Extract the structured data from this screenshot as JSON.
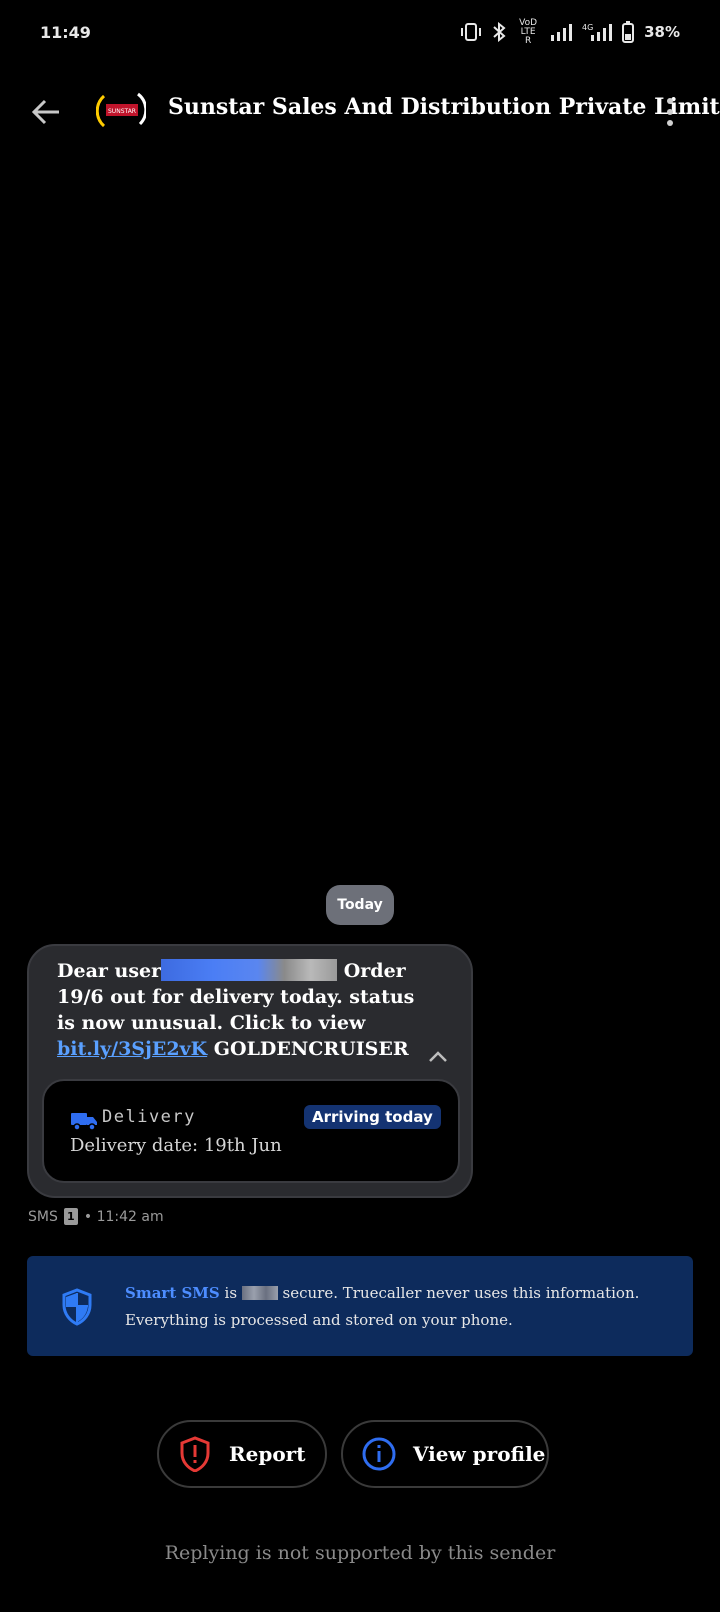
{
  "status_bar": {
    "time": "11:49",
    "network_volte": "VoD LTE R",
    "network_4g": "4G",
    "battery": "38%"
  },
  "header": {
    "sender_name": "Sunstar Sales And Distribution Private Limited",
    "avatar_text": "SUNSTAR"
  },
  "conversation": {
    "date_separator": "Today",
    "message": {
      "text_before_redaction": "Dear user",
      "text_after_redaction": " Order 19/6 out for delivery today. status is now unusual. Click to view ",
      "link_text": "bit.ly/3SjE2vK",
      "text_after_link": " GOLDENCRUISER",
      "delivery_card": {
        "label": "Delivery",
        "badge": "Arriving today",
        "date": "Delivery date: 19th Jun"
      },
      "meta_type": "SMS",
      "meta_sim": "1",
      "meta_time": "• 11:42 am"
    }
  },
  "secure_banner": {
    "smart_sms": "Smart SMS",
    "text_is": " is ",
    "text_rest": " secure. Truecaller never uses this information. Everything is processed and stored on your phone."
  },
  "actions": {
    "report_label": "Report",
    "view_profile_label": "View profile"
  },
  "footer_note": "Replying is not supported by this sender",
  "colors": {
    "background": "#000000",
    "bubble": "#2a2b2f",
    "link": "#5aa0ff",
    "badge": "#143372",
    "banner": "#0d2b5c",
    "report_red": "#e53935",
    "info_blue": "#2f6df0"
  }
}
